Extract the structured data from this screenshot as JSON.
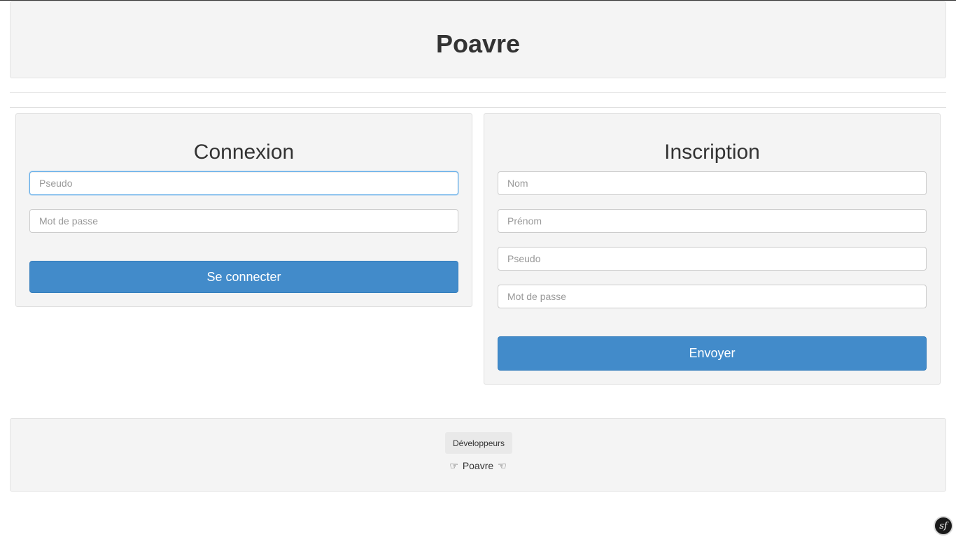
{
  "header": {
    "title": "Poavre"
  },
  "login": {
    "title": "Connexion",
    "fields": [
      {
        "placeholder": "Pseudo",
        "value": ""
      },
      {
        "placeholder": "Mot de passe",
        "value": ""
      }
    ],
    "submit_label": "Se connecter"
  },
  "signup": {
    "title": "Inscription",
    "fields": [
      {
        "placeholder": "Nom",
        "value": ""
      },
      {
        "placeholder": "Prénom",
        "value": ""
      },
      {
        "placeholder": "Pseudo",
        "value": ""
      },
      {
        "placeholder": "Mot de passe",
        "value": ""
      }
    ],
    "submit_label": "Envoyer"
  },
  "footer": {
    "badge_label": "Développeurs",
    "credit_left_icon": "☞",
    "credit_text": "Poavre",
    "credit_right_icon": "☜"
  },
  "debug_toolbar": {
    "label": "sf"
  },
  "colors": {
    "accent": "#428bca",
    "panel_bg": "#f4f4f4",
    "focus_border": "#66afe9"
  }
}
